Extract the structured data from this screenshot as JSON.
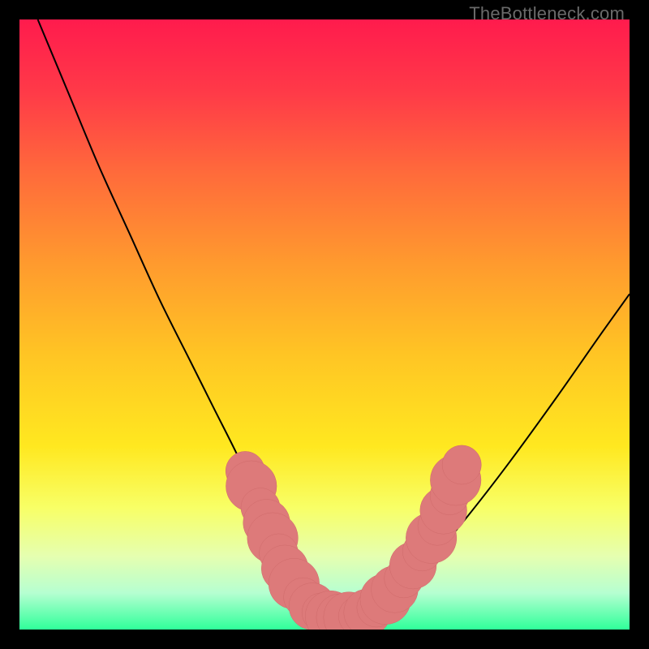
{
  "attribution": "TheBottleneck.com",
  "colors": {
    "frame": "#000000",
    "curve": "#000000",
    "marker_fill": "#dd7a7a",
    "marker_stroke": "#cf6a6a",
    "gradient_stops": [
      {
        "offset": 0.0,
        "color": "#ff1b4d"
      },
      {
        "offset": 0.12,
        "color": "#ff3a48"
      },
      {
        "offset": 0.25,
        "color": "#ff6a3b"
      },
      {
        "offset": 0.4,
        "color": "#ff9a2e"
      },
      {
        "offset": 0.55,
        "color": "#ffc524"
      },
      {
        "offset": 0.7,
        "color": "#ffe820"
      },
      {
        "offset": 0.8,
        "color": "#f8ff66"
      },
      {
        "offset": 0.88,
        "color": "#e5ffb0"
      },
      {
        "offset": 0.94,
        "color": "#b6ffd1"
      },
      {
        "offset": 1.0,
        "color": "#2fff9a"
      }
    ]
  },
  "chart_data": {
    "type": "line",
    "title": "",
    "xlabel": "",
    "ylabel": "",
    "xlim": [
      0,
      100
    ],
    "ylim": [
      0,
      100
    ],
    "annotations": [],
    "series": [
      {
        "name": "curve",
        "x": [
          3,
          8,
          13,
          18,
          23,
          28,
          32,
          36,
          39,
          42,
          45,
          47.5,
          50,
          52.5,
          55,
          58,
          62,
          67,
          73,
          80,
          88,
          95,
          100
        ],
        "y": [
          100,
          88,
          76,
          65,
          54,
          44,
          36,
          28,
          21,
          15,
          9,
          5,
          3,
          2,
          2,
          3,
          6,
          11,
          18,
          27,
          38,
          48,
          55
        ]
      }
    ],
    "markers": {
      "name": "dots",
      "points": [
        {
          "x": 37,
          "y": 26,
          "r": 1.0
        },
        {
          "x": 38,
          "y": 23.5,
          "r": 1.3
        },
        {
          "x": 39.5,
          "y": 20,
          "r": 1.0
        },
        {
          "x": 40.5,
          "y": 17.5,
          "r": 1.2
        },
        {
          "x": 41.5,
          "y": 15,
          "r": 1.3
        },
        {
          "x": 42.5,
          "y": 12.5,
          "r": 1.0
        },
        {
          "x": 43.5,
          "y": 10,
          "r": 1.2
        },
        {
          "x": 45,
          "y": 7.5,
          "r": 1.3
        },
        {
          "x": 46.5,
          "y": 5.3,
          "r": 1.0
        },
        {
          "x": 48,
          "y": 3.8,
          "r": 1.2
        },
        {
          "x": 49.5,
          "y": 2.8,
          "r": 1.0
        },
        {
          "x": 51,
          "y": 2.2,
          "r": 1.3
        },
        {
          "x": 52.5,
          "y": 2.0,
          "r": 1.2
        },
        {
          "x": 54,
          "y": 2.0,
          "r": 1.3
        },
        {
          "x": 55.5,
          "y": 2.2,
          "r": 1.0
        },
        {
          "x": 57,
          "y": 2.8,
          "r": 1.2
        },
        {
          "x": 58.5,
          "y": 3.6,
          "r": 1.0
        },
        {
          "x": 60,
          "y": 5.0,
          "r": 1.3
        },
        {
          "x": 61.5,
          "y": 6.6,
          "r": 1.2
        },
        {
          "x": 63,
          "y": 8.4,
          "r": 1.0
        },
        {
          "x": 64.5,
          "y": 10.5,
          "r": 1.2
        },
        {
          "x": 66,
          "y": 12.8,
          "r": 1.0
        },
        {
          "x": 67.5,
          "y": 15.0,
          "r": 1.3
        },
        {
          "x": 68.5,
          "y": 17.0,
          "r": 1.0
        },
        {
          "x": 69.5,
          "y": 19.5,
          "r": 1.2
        },
        {
          "x": 70.5,
          "y": 22.0,
          "r": 1.0
        },
        {
          "x": 71.5,
          "y": 24.5,
          "r": 1.3
        },
        {
          "x": 72.5,
          "y": 27.0,
          "r": 1.0
        }
      ]
    }
  }
}
